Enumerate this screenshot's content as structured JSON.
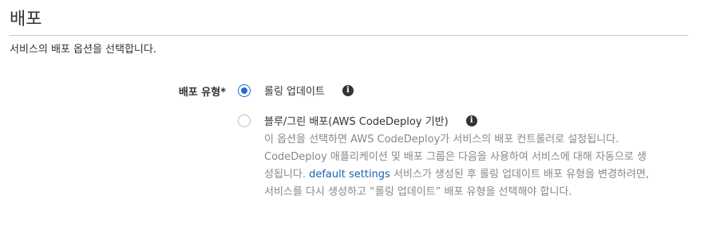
{
  "section": {
    "title": "배포",
    "description": "서비스의 배포 옵션을 선택합니다."
  },
  "deployment_type": {
    "label": "배포 유형*",
    "options": [
      {
        "label": "롤링 업데이트",
        "selected": true,
        "info_icon": "info-circle-icon"
      },
      {
        "label": "블루/그린 배포(AWS CodeDeploy 기반)",
        "selected": false,
        "info_icon": "info-circle-icon"
      }
    ],
    "help": {
      "text_before": "이 옵션을 선택하면 AWS CodeDeploy가 서비스의 배포 컨트롤러로 설정됩니다. CodeDeploy 애플리케이션 및 배포 그룹은 다음을 사용하여 서비스에 대해 자동으로 생성됩니다. ",
      "link": "default settings",
      "text_after": " 서비스가 생성된 후 롤링 업데이트 배포 유형을 변경하려면, 서비스를 다시 생성하고 “롤링 업데이트” 배포 유형을 선택해야 합니다."
    }
  },
  "colors": {
    "accent": "#1f6fd0",
    "link": "#1a61b3",
    "help_text": "#888888",
    "text": "#333333"
  }
}
